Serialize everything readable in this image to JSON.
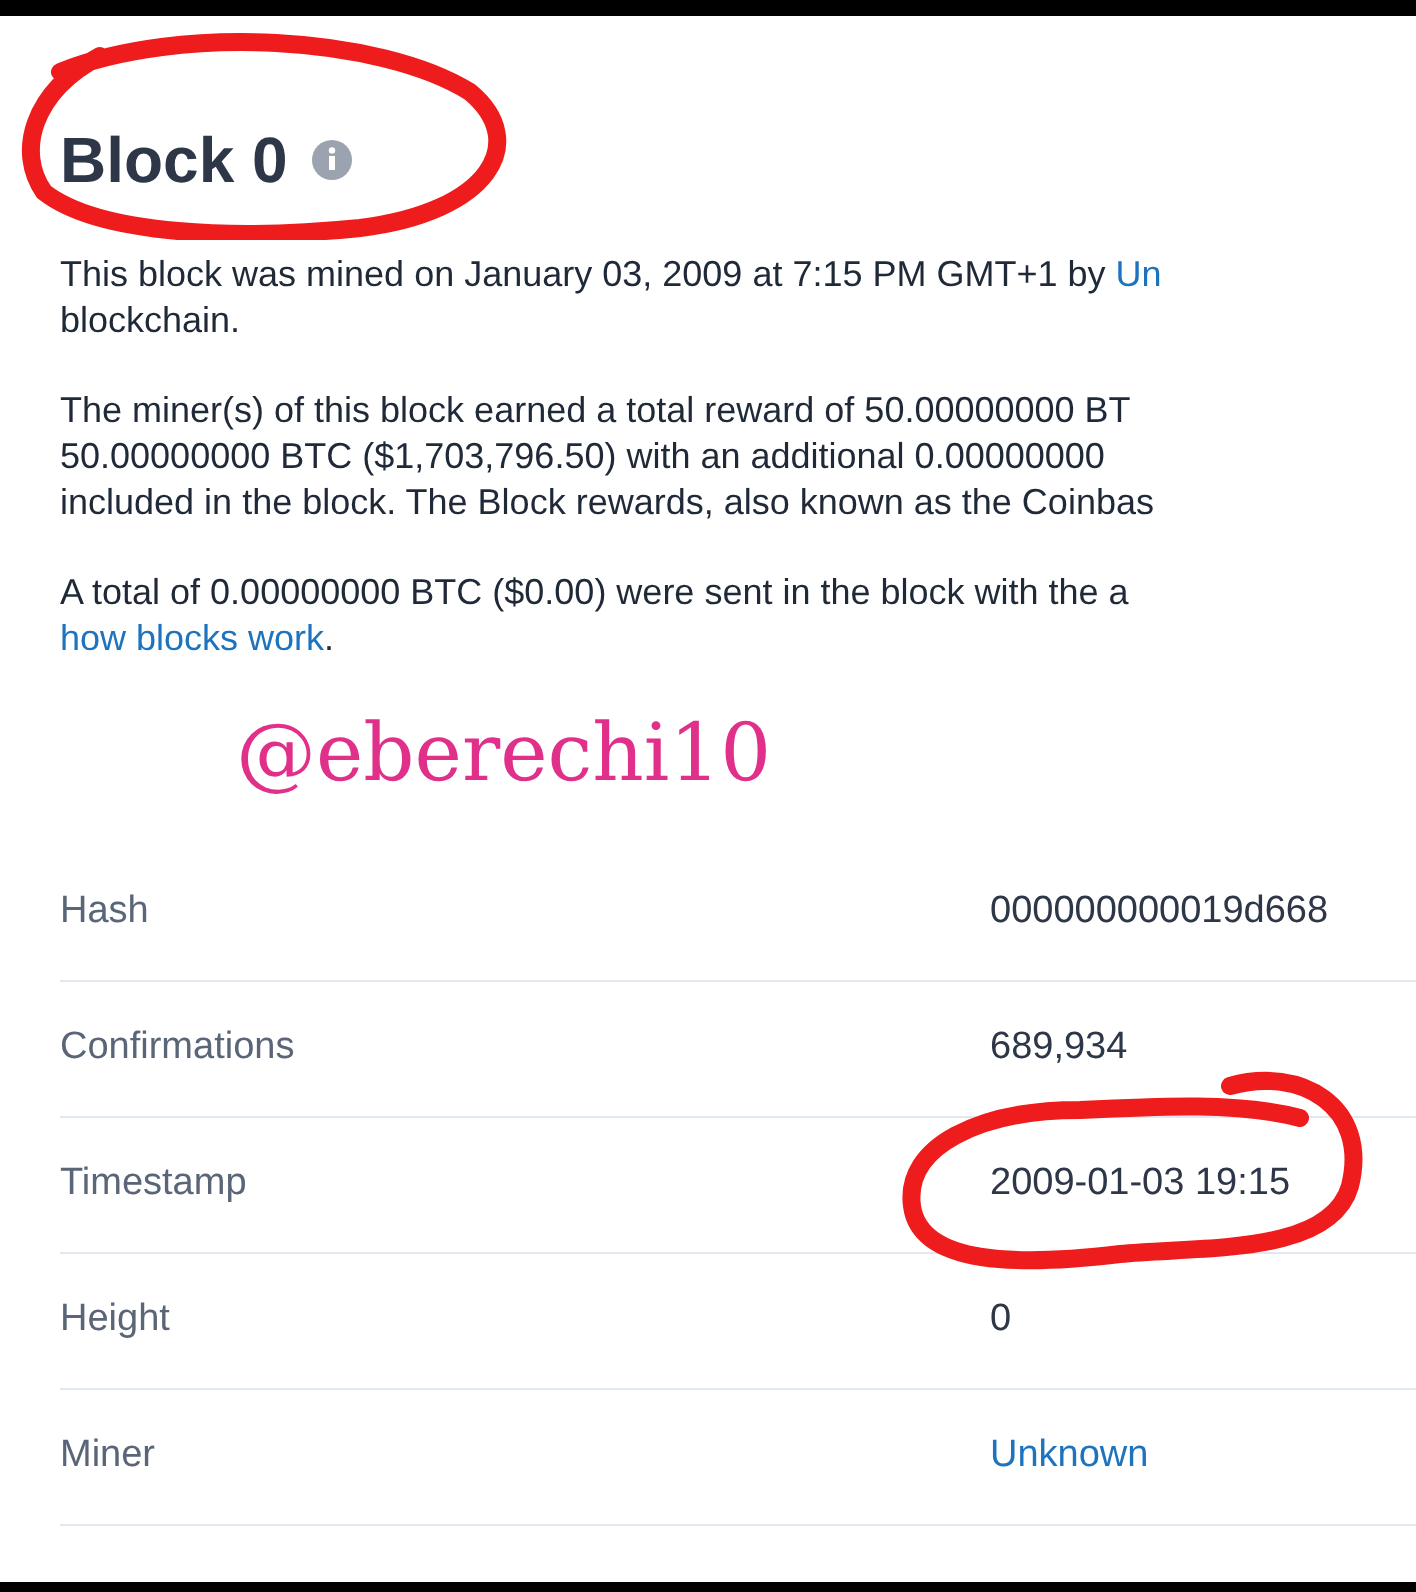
{
  "title": "Block 0",
  "paragraphs": [
    {
      "lines": [
        {
          "parts": [
            {
              "text": "This block was mined on January 03, 2009 at 7:15 PM GMT+1 by ",
              "link": false
            },
            {
              "text": "Un",
              "link": true
            }
          ]
        },
        {
          "parts": [
            {
              "text": "blockchain.",
              "link": false
            }
          ]
        }
      ]
    },
    {
      "lines": [
        {
          "parts": [
            {
              "text": "The miner(s) of this block earned a total reward of 50.00000000 BT",
              "link": false
            }
          ]
        },
        {
          "parts": [
            {
              "text": "50.00000000 BTC ($1,703,796.50) with an additional 0.00000000",
              "link": false
            }
          ]
        },
        {
          "parts": [
            {
              "text": "included in the block. The Block rewards, also known as the Coinbas",
              "link": false
            }
          ]
        }
      ]
    },
    {
      "lines": [
        {
          "parts": [
            {
              "text": "A total of 0.00000000 BTC ($0.00) were sent in the block with the a",
              "link": false
            }
          ]
        },
        {
          "parts": [
            {
              "text": "how blocks work",
              "link": true
            },
            {
              "text": ".",
              "link": false
            }
          ]
        }
      ]
    }
  ],
  "annotation": {
    "text": "@eberechi10"
  },
  "details": [
    {
      "label": "Hash",
      "value": "000000000019d668",
      "link": false,
      "circled": false
    },
    {
      "label": "Confirmations",
      "value": "689,934",
      "link": false,
      "circled": false
    },
    {
      "label": "Timestamp",
      "value": "2009-01-03 19:15",
      "link": false,
      "circled": true
    },
    {
      "label": "Height",
      "value": "0",
      "link": false,
      "circled": false
    },
    {
      "label": "Miner",
      "value": "Unknown",
      "link": true,
      "circled": false
    }
  ]
}
